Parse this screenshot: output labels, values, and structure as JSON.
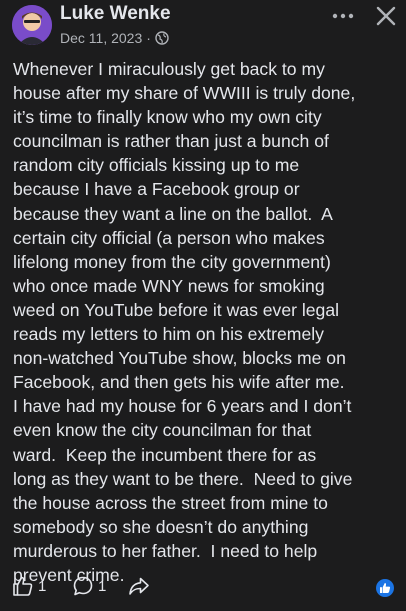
{
  "post": {
    "author": "Luke Wenke",
    "date": "Dec 11, 2023",
    "separator": "·",
    "privacy_icon": "globe-icon",
    "body_lines": [
      "Whenever I miraculously get back to my",
      "house after my share of WWIII is truly done,",
      "it’s time to finally know who my own city",
      "councilman is rather than just a bunch of",
      "random city officials kissing up to me",
      "because I have a Facebook group or",
      "because they want a line on the ballot.  A",
      "certain city official (a person who makes",
      "lifelong money from the city government)",
      "who once made WNY news for smoking",
      "weed on YouTube before it was ever legal",
      "reads my letters to him on his extremely",
      "non-watched YouTube show, blocks me on",
      "Facebook, and then gets his wife after me.",
      "I have had my house for 6 years and I don’t",
      "even know the city councilman for that",
      "ward.  Keep the incumbent there for as",
      "long as they want to be there.  Need to give",
      "the house across the street from mine to",
      "somebody so she doesn’t do anything",
      "murderous to her father.  I need to help",
      "prevent crime."
    ],
    "like_count": "1",
    "comment_count": "1"
  },
  "icons": {
    "more": "more-dots-icon",
    "close": "close-icon",
    "like": "thumbs-up-icon",
    "comment": "comment-bubble-icon",
    "share": "share-arrow-icon",
    "reaction": "like-reaction-icon"
  },
  "colors": {
    "background": "#1c1c1d",
    "text": "#e4e6eb",
    "secondary_text": "#b0b3b8",
    "accent": "#1b74e4"
  }
}
